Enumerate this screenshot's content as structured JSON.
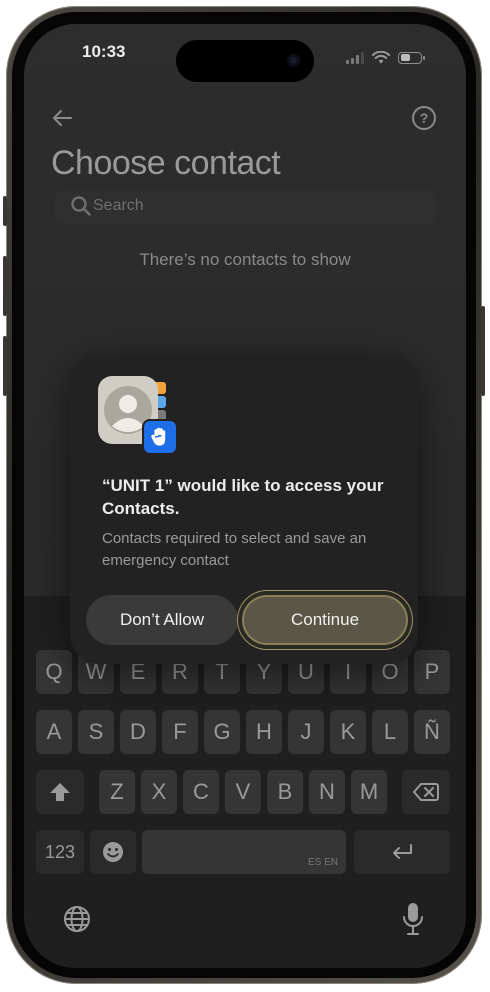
{
  "status_bar": {
    "time": "10:33"
  },
  "header": {
    "title": "Choose contact"
  },
  "search": {
    "placeholder": "Search"
  },
  "empty_state": {
    "message": "There’s no contacts to show"
  },
  "dialog": {
    "title": "“UNIT 1” would like to access your Contacts.",
    "message": "Contacts required to select and save an emergency contact",
    "deny_label": "Don’t Allow",
    "continue_label": "Continue"
  },
  "keyboard": {
    "row1": [
      "Q",
      "W",
      "E",
      "R",
      "T",
      "Y",
      "U",
      "I",
      "O",
      "P"
    ],
    "row2": [
      "A",
      "S",
      "D",
      "F",
      "G",
      "H",
      "J",
      "K",
      "L",
      "Ñ"
    ],
    "row3": [
      "Z",
      "X",
      "C",
      "V",
      "B",
      "N",
      "M"
    ],
    "numbers_label": "123",
    "space_label": "ES EN"
  },
  "icons": {
    "back": "arrow-left-icon",
    "help": "question-circle-icon",
    "search": "search-icon",
    "shift": "shift-arrow-icon",
    "delete": "backspace-icon",
    "emoji": "emoji-icon",
    "return": "return-icon",
    "globe": "globe-icon",
    "mic": "microphone-icon"
  },
  "colors": {
    "accent_button": "#5b5646",
    "badge_blue": "#1e6ee8"
  }
}
